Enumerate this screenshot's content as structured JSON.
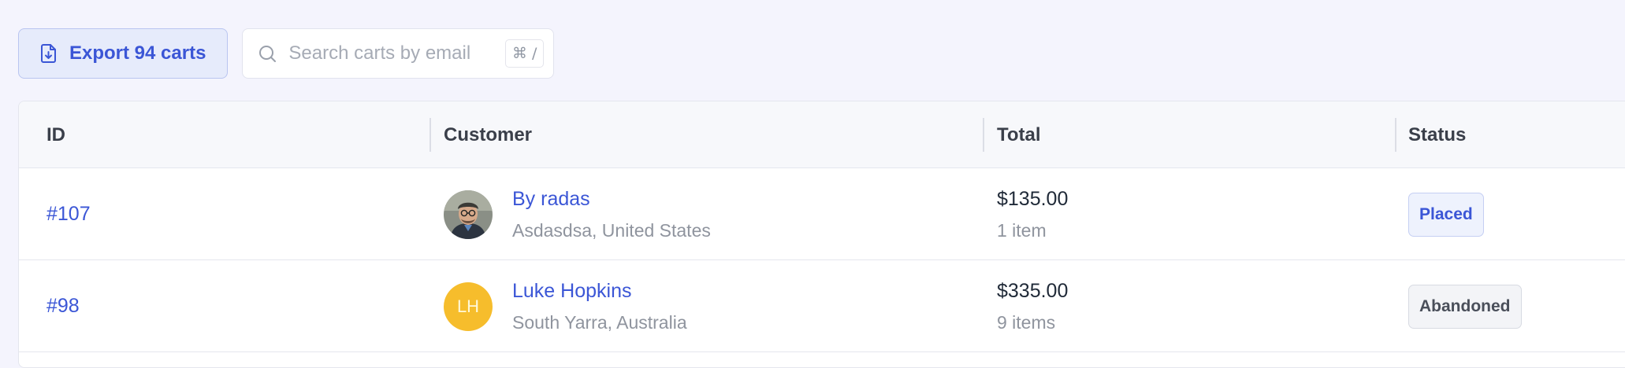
{
  "toolbar": {
    "export_label": "Export 94 carts",
    "search_placeholder": "Search carts by email",
    "shortcut": "⌘ /"
  },
  "table": {
    "columns": [
      "ID",
      "Customer",
      "Total",
      "Status"
    ],
    "rows": [
      {
        "id": "#107",
        "customer_name": "By radas",
        "customer_location": "Asdasdsa, United States",
        "avatar": "photo",
        "total": "$135.00",
        "items": "1 item",
        "status": "Placed"
      },
      {
        "id": "#98",
        "customer_name": "Luke Hopkins",
        "customer_location": "South Yarra, Australia",
        "avatar_initials": "LH",
        "total": "$335.00",
        "items": "9 items",
        "status": "Abandoned"
      }
    ]
  },
  "colors": {
    "accent": "#3b56d6",
    "background": "#f4f4fd",
    "avatar_yellow": "#f6bd2c"
  },
  "icons": {
    "export": "file-download-icon",
    "search": "search-icon"
  }
}
